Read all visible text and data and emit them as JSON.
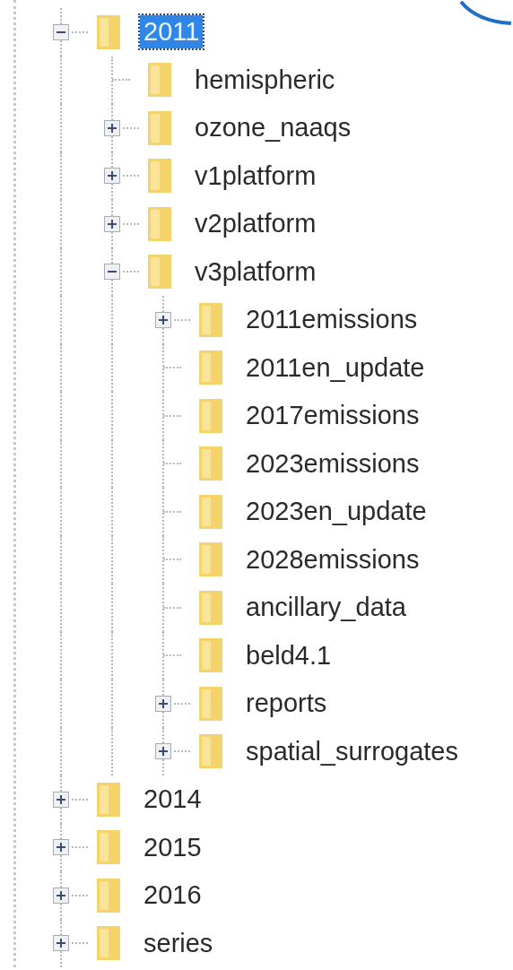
{
  "tree": [
    {
      "label": "2011",
      "selected": true,
      "expanded": true,
      "children": [
        {
          "label": "hemispheric",
          "selected": false
        },
        {
          "label": "ozone_naaqs",
          "selected": false,
          "expanded": false
        },
        {
          "label": "v1platform",
          "selected": false,
          "expanded": false
        },
        {
          "label": "v2platform",
          "selected": false,
          "expanded": false
        },
        {
          "label": "v3platform",
          "selected": false,
          "expanded": true,
          "children": [
            {
              "label": "2011emissions",
              "selected": false,
              "expanded": false
            },
            {
              "label": "2011en_update",
              "selected": false
            },
            {
              "label": "2017emissions",
              "selected": false
            },
            {
              "label": "2023emissions",
              "selected": false
            },
            {
              "label": "2023en_update",
              "selected": false
            },
            {
              "label": "2028emissions",
              "selected": false
            },
            {
              "label": "ancillary_data",
              "selected": false
            },
            {
              "label": "beld4.1",
              "selected": false
            },
            {
              "label": "reports",
              "selected": false,
              "expanded": false
            },
            {
              "label": "spatial_surrogates",
              "selected": false,
              "expanded": false
            }
          ]
        }
      ]
    },
    {
      "label": "2014",
      "selected": false,
      "expanded": false
    },
    {
      "label": "2015",
      "selected": false,
      "expanded": false
    },
    {
      "label": "2016",
      "selected": false,
      "expanded": false
    },
    {
      "label": "series",
      "selected": false,
      "expanded": false
    }
  ]
}
